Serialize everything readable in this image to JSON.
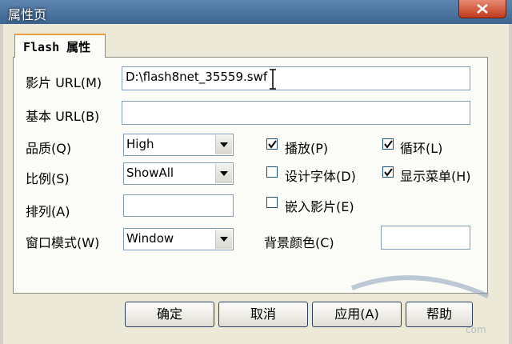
{
  "window": {
    "title": "属性页"
  },
  "tab": {
    "label": "Flash 属性"
  },
  "fields": {
    "movie_url": {
      "label": "影片 URL(M)",
      "value": "D:\\flash8net_35559.swf"
    },
    "base_url": {
      "label": "基本 URL(B)",
      "value": ""
    },
    "quality": {
      "label": "品质(Q)",
      "value": "High"
    },
    "scale": {
      "label": "比例(S)",
      "value": "ShowAll"
    },
    "align": {
      "label": "排列(A)",
      "value": ""
    },
    "window_mode": {
      "label": "窗口模式(W)",
      "value": "Window"
    },
    "bgcolor": {
      "label": "背景颜色(C)",
      "value": ""
    }
  },
  "checkboxes": {
    "play": {
      "label": "播放(P)",
      "checked": true
    },
    "loop": {
      "label": "循环(L)",
      "checked": true
    },
    "device_font": {
      "label": "设计字体(D)",
      "checked": false
    },
    "show_menu": {
      "label": "显示菜单(H)",
      "checked": true
    },
    "embed_movie": {
      "label": "嵌入影片(E)",
      "checked": false
    }
  },
  "buttons": {
    "ok": "确定",
    "cancel": "取消",
    "apply": "应用(A)",
    "help": "帮助"
  },
  "watermark": {
    "text": "com"
  }
}
